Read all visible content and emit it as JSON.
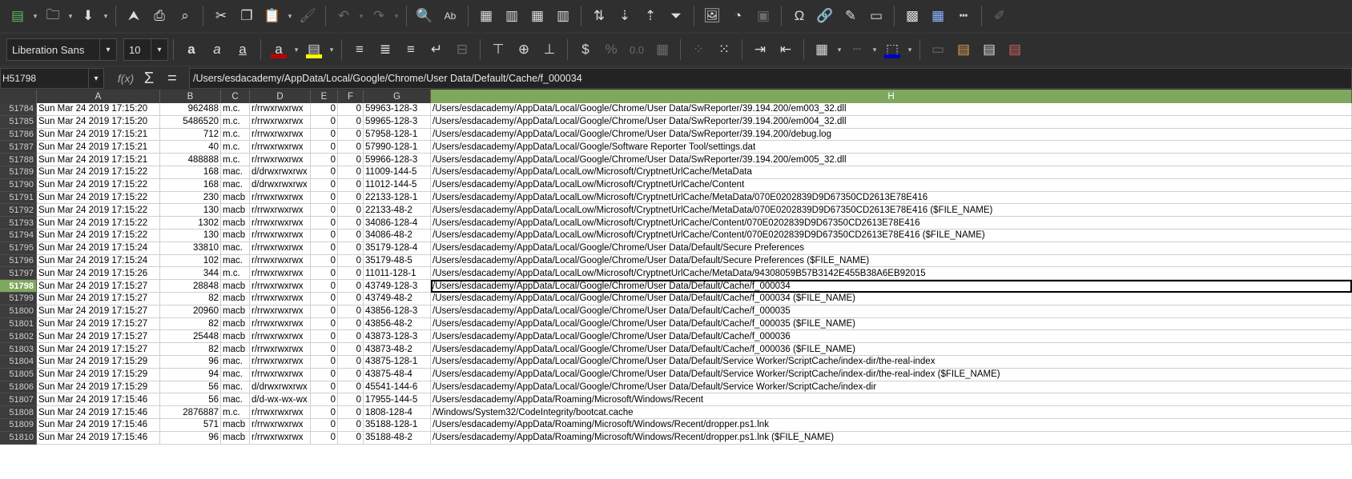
{
  "toolbar": {
    "font_name": "Liberation Sans",
    "font_size": "10",
    "accent_colors": {
      "font_color": "#c00000",
      "highlight_color": "#ffff00",
      "border_color": "#0000c0",
      "currency_symbol": "$",
      "percent_symbol": "%",
      "decimal_label": "0.0"
    }
  },
  "formula_bar": {
    "name_box": "H51798",
    "fx_label": "f(x)",
    "sigma": "Σ",
    "equals": "=",
    "content": "/Users/esdacademy/AppData/Local/Google/Chrome/User Data/Default/Cache/f_000034"
  },
  "columns": [
    "A",
    "B",
    "C",
    "D",
    "E",
    "F",
    "G",
    "H"
  ],
  "selected_column": "H",
  "selected_row": "51798",
  "rows": [
    {
      "n": "51784",
      "a": "Sun Mar 24 2019 17:15:20",
      "b": "962488",
      "c": "m.c.",
      "d": "r/rrwxrwxrwx",
      "e": "0",
      "f": "0",
      "g": "59963-128-3",
      "h": "/Users/esdacademy/AppData/Local/Google/Chrome/User Data/SwReporter/39.194.200/em003_32.dll"
    },
    {
      "n": "51785",
      "a": "Sun Mar 24 2019 17:15:20",
      "b": "5486520",
      "c": "m.c.",
      "d": "r/rrwxrwxrwx",
      "e": "0",
      "f": "0",
      "g": "59965-128-3",
      "h": "/Users/esdacademy/AppData/Local/Google/Chrome/User Data/SwReporter/39.194.200/em004_32.dll"
    },
    {
      "n": "51786",
      "a": "Sun Mar 24 2019 17:15:21",
      "b": "712",
      "c": "m.c.",
      "d": "r/rrwxrwxrwx",
      "e": "0",
      "f": "0",
      "g": "57958-128-1",
      "h": "/Users/esdacademy/AppData/Local/Google/Chrome/User Data/SwReporter/39.194.200/debug.log"
    },
    {
      "n": "51787",
      "a": "Sun Mar 24 2019 17:15:21",
      "b": "40",
      "c": "m.c.",
      "d": "r/rrwxrwxrwx",
      "e": "0",
      "f": "0",
      "g": "57990-128-1",
      "h": "/Users/esdacademy/AppData/Local/Google/Software Reporter Tool/settings.dat"
    },
    {
      "n": "51788",
      "a": "Sun Mar 24 2019 17:15:21",
      "b": "488888",
      "c": "m.c.",
      "d": "r/rrwxrwxrwx",
      "e": "0",
      "f": "0",
      "g": "59966-128-3",
      "h": "/Users/esdacademy/AppData/Local/Google/Chrome/User Data/SwReporter/39.194.200/em005_32.dll"
    },
    {
      "n": "51789",
      "a": "Sun Mar 24 2019 17:15:22",
      "b": "168",
      "c": "mac.",
      "d": "d/drwxrwxrwx",
      "e": "0",
      "f": "0",
      "g": "11009-144-5",
      "h": "/Users/esdacademy/AppData/LocalLow/Microsoft/CryptnetUrlCache/MetaData"
    },
    {
      "n": "51790",
      "a": "Sun Mar 24 2019 17:15:22",
      "b": "168",
      "c": "mac.",
      "d": "d/drwxrwxrwx",
      "e": "0",
      "f": "0",
      "g": "11012-144-5",
      "h": "/Users/esdacademy/AppData/LocalLow/Microsoft/CryptnetUrlCache/Content"
    },
    {
      "n": "51791",
      "a": "Sun Mar 24 2019 17:15:22",
      "b": "230",
      "c": "macb",
      "d": "r/rrwxrwxrwx",
      "e": "0",
      "f": "0",
      "g": "22133-128-1",
      "h": "/Users/esdacademy/AppData/LocalLow/Microsoft/CryptnetUrlCache/MetaData/070E0202839D9D67350CD2613E78E416"
    },
    {
      "n": "51792",
      "a": "Sun Mar 24 2019 17:15:22",
      "b": "130",
      "c": "macb",
      "d": "r/rrwxrwxrwx",
      "e": "0",
      "f": "0",
      "g": "22133-48-2",
      "h": "/Users/esdacademy/AppData/LocalLow/Microsoft/CryptnetUrlCache/MetaData/070E0202839D9D67350CD2613E78E416 ($FILE_NAME)"
    },
    {
      "n": "51793",
      "a": "Sun Mar 24 2019 17:15:22",
      "b": "1302",
      "c": "macb",
      "d": "r/rrwxrwxrwx",
      "e": "0",
      "f": "0",
      "g": "34086-128-4",
      "h": "/Users/esdacademy/AppData/LocalLow/Microsoft/CryptnetUrlCache/Content/070E0202839D9D67350CD2613E78E416"
    },
    {
      "n": "51794",
      "a": "Sun Mar 24 2019 17:15:22",
      "b": "130",
      "c": "macb",
      "d": "r/rrwxrwxrwx",
      "e": "0",
      "f": "0",
      "g": "34086-48-2",
      "h": "/Users/esdacademy/AppData/LocalLow/Microsoft/CryptnetUrlCache/Content/070E0202839D9D67350CD2613E78E416 ($FILE_NAME)"
    },
    {
      "n": "51795",
      "a": "Sun Mar 24 2019 17:15:24",
      "b": "33810",
      "c": "mac.",
      "d": "r/rrwxrwxrwx",
      "e": "0",
      "f": "0",
      "g": "35179-128-4",
      "h": "/Users/esdacademy/AppData/Local/Google/Chrome/User Data/Default/Secure Preferences"
    },
    {
      "n": "51796",
      "a": "Sun Mar 24 2019 17:15:24",
      "b": "102",
      "c": "mac.",
      "d": "r/rrwxrwxrwx",
      "e": "0",
      "f": "0",
      "g": "35179-48-5",
      "h": "/Users/esdacademy/AppData/Local/Google/Chrome/User Data/Default/Secure Preferences ($FILE_NAME)"
    },
    {
      "n": "51797",
      "a": "Sun Mar 24 2019 17:15:26",
      "b": "344",
      "c": "m.c.",
      "d": "r/rrwxrwxrwx",
      "e": "0",
      "f": "0",
      "g": "11011-128-1",
      "h": "/Users/esdacademy/AppData/LocalLow/Microsoft/CryptnetUrlCache/MetaData/94308059B57B3142E455B38A6EB92015"
    },
    {
      "n": "51798",
      "a": "Sun Mar 24 2019 17:15:27",
      "b": "28848",
      "c": "macb",
      "d": "r/rrwxrwxrwx",
      "e": "0",
      "f": "0",
      "g": "43749-128-3",
      "h": "/Users/esdacademy/AppData/Local/Google/Chrome/User Data/Default/Cache/f_000034"
    },
    {
      "n": "51799",
      "a": "Sun Mar 24 2019 17:15:27",
      "b": "82",
      "c": "macb",
      "d": "r/rrwxrwxrwx",
      "e": "0",
      "f": "0",
      "g": "43749-48-2",
      "h": "/Users/esdacademy/AppData/Local/Google/Chrome/User Data/Default/Cache/f_000034 ($FILE_NAME)"
    },
    {
      "n": "51800",
      "a": "Sun Mar 24 2019 17:15:27",
      "b": "20960",
      "c": "macb",
      "d": "r/rrwxrwxrwx",
      "e": "0",
      "f": "0",
      "g": "43856-128-3",
      "h": "/Users/esdacademy/AppData/Local/Google/Chrome/User Data/Default/Cache/f_000035"
    },
    {
      "n": "51801",
      "a": "Sun Mar 24 2019 17:15:27",
      "b": "82",
      "c": "macb",
      "d": "r/rrwxrwxrwx",
      "e": "0",
      "f": "0",
      "g": "43856-48-2",
      "h": "/Users/esdacademy/AppData/Local/Google/Chrome/User Data/Default/Cache/f_000035 ($FILE_NAME)"
    },
    {
      "n": "51802",
      "a": "Sun Mar 24 2019 17:15:27",
      "b": "25448",
      "c": "macb",
      "d": "r/rrwxrwxrwx",
      "e": "0",
      "f": "0",
      "g": "43873-128-3",
      "h": "/Users/esdacademy/AppData/Local/Google/Chrome/User Data/Default/Cache/f_000036"
    },
    {
      "n": "51803",
      "a": "Sun Mar 24 2019 17:15:27",
      "b": "82",
      "c": "macb",
      "d": "r/rrwxrwxrwx",
      "e": "0",
      "f": "0",
      "g": "43873-48-2",
      "h": "/Users/esdacademy/AppData/Local/Google/Chrome/User Data/Default/Cache/f_000036 ($FILE_NAME)"
    },
    {
      "n": "51804",
      "a": "Sun Mar 24 2019 17:15:29",
      "b": "96",
      "c": "mac.",
      "d": "r/rrwxrwxrwx",
      "e": "0",
      "f": "0",
      "g": "43875-128-1",
      "h": "/Users/esdacademy/AppData/Local/Google/Chrome/User Data/Default/Service Worker/ScriptCache/index-dir/the-real-index"
    },
    {
      "n": "51805",
      "a": "Sun Mar 24 2019 17:15:29",
      "b": "94",
      "c": "mac.",
      "d": "r/rrwxrwxrwx",
      "e": "0",
      "f": "0",
      "g": "43875-48-4",
      "h": "/Users/esdacademy/AppData/Local/Google/Chrome/User Data/Default/Service Worker/ScriptCache/index-dir/the-real-index ($FILE_NAME)"
    },
    {
      "n": "51806",
      "a": "Sun Mar 24 2019 17:15:29",
      "b": "56",
      "c": "mac.",
      "d": "d/drwxrwxrwx",
      "e": "0",
      "f": "0",
      "g": "45541-144-6",
      "h": "/Users/esdacademy/AppData/Local/Google/Chrome/User Data/Default/Service Worker/ScriptCache/index-dir"
    },
    {
      "n": "51807",
      "a": "Sun Mar 24 2019 17:15:46",
      "b": "56",
      "c": "mac.",
      "d": "d/d-wx-wx-wx",
      "e": "0",
      "f": "0",
      "g": "17955-144-5",
      "h": "/Users/esdacademy/AppData/Roaming/Microsoft/Windows/Recent"
    },
    {
      "n": "51808",
      "a": "Sun Mar 24 2019 17:15:46",
      "b": "2876887",
      "c": "m.c.",
      "d": "r/rrwxrwxrwx",
      "e": "0",
      "f": "0",
      "g": "1808-128-4",
      "h": "/Windows/System32/CodeIntegrity/bootcat.cache"
    },
    {
      "n": "51809",
      "a": "Sun Mar 24 2019 17:15:46",
      "b": "571",
      "c": "macb",
      "d": "r/rrwxrwxrwx",
      "e": "0",
      "f": "0",
      "g": "35188-128-1",
      "h": "/Users/esdacademy/AppData/Roaming/Microsoft/Windows/Recent/dropper.ps1.lnk"
    },
    {
      "n": "51810",
      "a": "Sun Mar 24 2019 17:15:46",
      "b": "96",
      "c": "macb",
      "d": "r/rrwxrwxrwx",
      "e": "0",
      "f": "0",
      "g": "35188-48-2",
      "h": "/Users/esdacademy/AppData/Roaming/Microsoft/Windows/Recent/dropper.ps1.lnk ($FILE_NAME)"
    }
  ]
}
